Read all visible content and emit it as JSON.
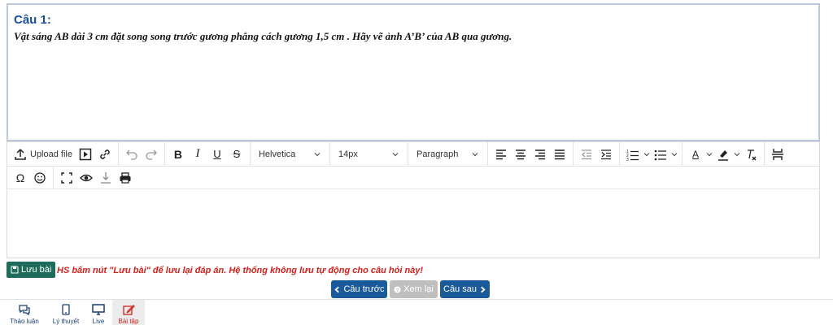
{
  "question": {
    "title": "Câu 1:",
    "text": "Vật sáng AB  dài 3 cm đặt  song song trước gương phẳng  cách gương 1,5 cm . Hãy vẽ ảnh A’B’ của AB qua gương."
  },
  "toolbar": {
    "upload_label": "Upload file",
    "bold": "B",
    "italic": "I",
    "underline": "U",
    "strike": "S",
    "font_family": "Helvetica",
    "font_size": "14px",
    "block_format": "Paragraph",
    "font_color": "A",
    "omega": "Ω"
  },
  "actions": {
    "save_label": "Lưu bài",
    "warning": "HS bấm nút \"Lưu bài\" để lưu lại đáp án. Hệ thống không lưu tự động cho câu hỏi này!",
    "prev_label": "Câu trước",
    "review_label": "Xem lại",
    "next_label": "Câu sau"
  },
  "bottom_nav": [
    {
      "label": "Thảo luận",
      "icon": "chat-icon"
    },
    {
      "label": "Lý thuyết",
      "icon": "tablet-icon"
    },
    {
      "label": "Live",
      "icon": "monitor-icon"
    },
    {
      "label": "Bài tập",
      "icon": "edit-icon",
      "active": true
    }
  ],
  "colors": {
    "title_blue": "#1a4fa0",
    "warning_red": "#d0211c",
    "save_green": "#1e6b5c",
    "nav_blue": "#1a5a9a",
    "disabled_gray": "#bfbfbf"
  }
}
